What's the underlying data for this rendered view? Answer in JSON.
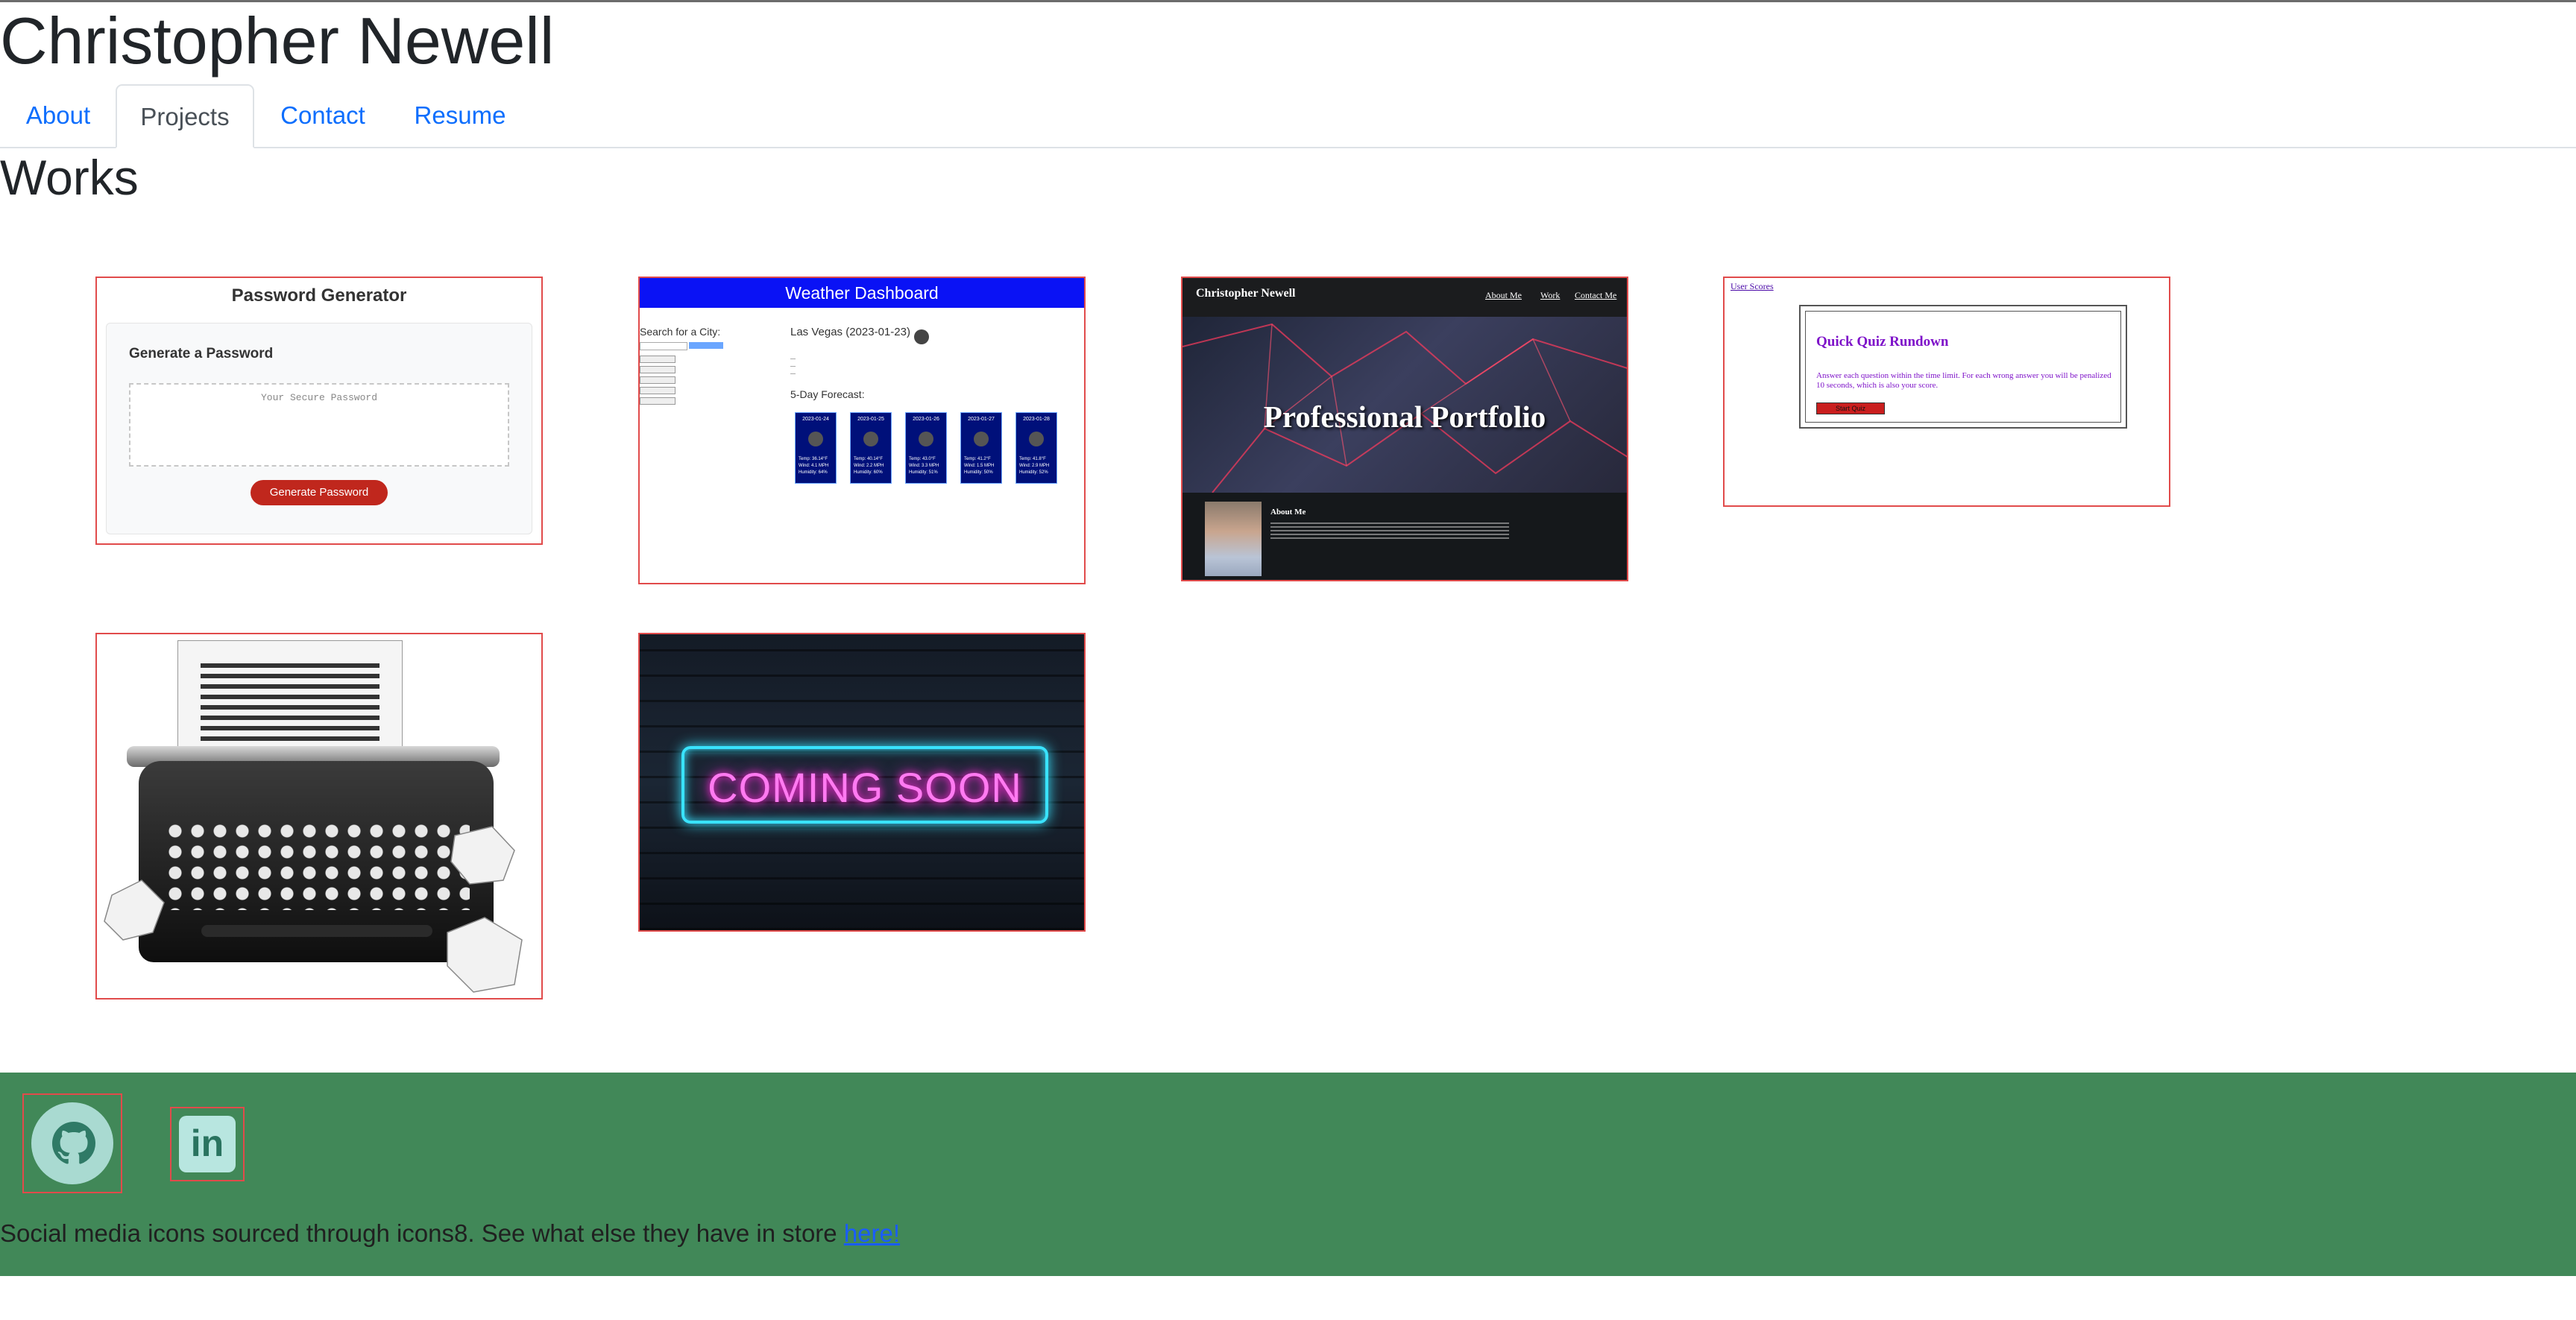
{
  "header": {
    "name": "Christopher Newell"
  },
  "nav": {
    "tabs": [
      {
        "label": "About"
      },
      {
        "label": "Projects"
      },
      {
        "label": "Contact"
      },
      {
        "label": "Resume"
      }
    ],
    "active": "Projects"
  },
  "section": {
    "title": "Works"
  },
  "projects": {
    "password": {
      "title": "Password Generator",
      "subtitle": "Generate a Password",
      "placeholder": "Your Secure Password",
      "button": "Generate Password"
    },
    "weather": {
      "header": "Weather Dashboard",
      "search_label": "Search for a City:",
      "city": "Las Vegas (2023-01-23)",
      "forecast_label": "5-Day Forecast:",
      "days": [
        {
          "date": "2023-01-24",
          "detail": "Temp: 36.14°F Wind: 4.1 MPH Humidity: 64%"
        },
        {
          "date": "2023-01-25",
          "detail": "Temp: 40.14°F Wind: 2.2 MPH Humidity: 60%"
        },
        {
          "date": "2023-01-26",
          "detail": "Temp: 43.0°F Wind: 3.3 MPH Humidity: 51%"
        },
        {
          "date": "2023-01-27",
          "detail": "Temp: 41.2°F Wind: 1.5 MPH Humidity: 50%"
        },
        {
          "date": "2023-01-28",
          "detail": "Temp: 41.8°F Wind: 2.9 MPH Humidity: 52%"
        }
      ]
    },
    "portfolio": {
      "name": "Christopher Newell",
      "links": [
        "About Me",
        "Work",
        "Contact Me"
      ],
      "hero_title": "Professional Portfolio",
      "about_heading": "About Me"
    },
    "quiz": {
      "scores_link": "User Scores",
      "title": "Quick Quiz Rundown",
      "description": "Answer each question within the time limit. For each wrong answer you will be penalized 10 seconds, which is also your score.",
      "start_button": "Start Quiz"
    },
    "coming_soon": {
      "text": "COMING SOON"
    }
  },
  "footer": {
    "credit_text": "Social media icons sourced through icons8. See what else they have in store ",
    "credit_link": "here!",
    "icons": [
      "github-icon",
      "linkedin-icon"
    ],
    "background": "#418858"
  },
  "colors": {
    "accent_link": "#0d6efd",
    "card_border": "#e14b4b"
  }
}
